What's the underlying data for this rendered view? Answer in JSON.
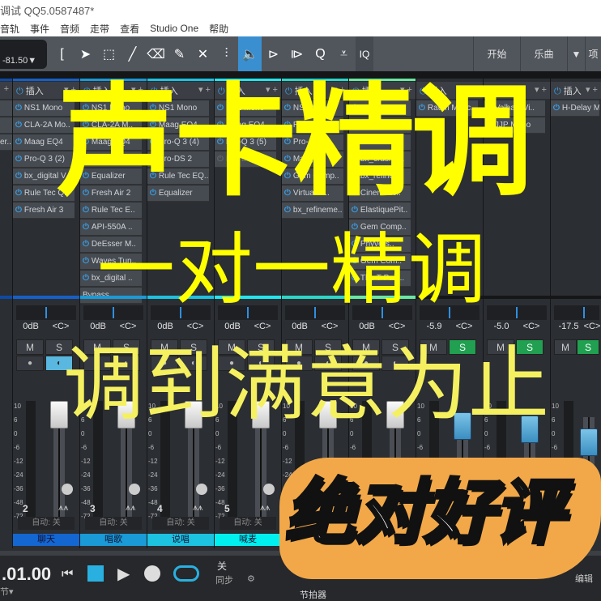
{
  "window": {
    "title": "调试 QQ5.0587487*"
  },
  "menu": [
    "音轨",
    "事件",
    "音频",
    "走带",
    "查看",
    "Studio One",
    "帮助"
  ],
  "toolbar": {
    "time": "-81.50▼",
    "tools": [
      "bracket",
      "arrow",
      "range",
      "paint",
      "eraser",
      "pencil",
      "mute",
      "split",
      "listen",
      "bend",
      "strip-silence",
      "quantize",
      "transform"
    ],
    "iq": "IQ",
    "buttons": [
      "开始",
      "乐曲",
      "▼",
      "项"
    ]
  },
  "insert_header": "插入",
  "strips": [
    {
      "num": "",
      "color": "#0d4aa6",
      "inserts": [
        "",
        "",
        "er.."
      ],
      "vol": "",
      "pan": "",
      "solo": false,
      "label": "",
      "label_color": "#1062c8"
    },
    {
      "num": "2",
      "color": "#1560c8",
      "inserts": [
        "NS1 Mono",
        "CLA-2A Mo..",
        "Maag EQ4",
        "Pro-Q 3 (2)",
        "bx_digital V",
        "Rule Tec Q..",
        "Fresh Air 3"
      ],
      "vol": "0dB",
      "pan": "<C>",
      "solo": false,
      "label": "聊天",
      "label_color": "#1466d0"
    },
    {
      "num": "3",
      "color": "#1a9ad6",
      "inserts": [
        "NS1 Mono",
        "CLA-2A M..",
        "Maag EQ4",
        "Pro-Q 3 (3)",
        "Equalizer",
        "Fresh Air 2",
        "Rule Tec E..",
        "API-550A ..",
        "DeEsser M..",
        "Waves Tun..",
        "bx_digital ..",
        "Bypass"
      ],
      "vol": "0dB",
      "pan": "<C>",
      "solo": false,
      "label": "唱歌",
      "label_color": "#1a9ad6"
    },
    {
      "num": "4",
      "color": "#1cc2e0",
      "inserts": [
        "NS1 Mono",
        "Maag EQ4",
        "Pro-Q 3 (4)",
        "Pro-DS 2",
        "Rule Tec EQ..",
        "Equalizer"
      ],
      "vol": "0dB",
      "pan": "<C>",
      "solo": false,
      "label": "说唱",
      "label_color": "#1cc2e0"
    },
    {
      "num": "5",
      "color": "#22e6ee",
      "inserts": [
        "NS1 Mono",
        "Maag EQ4",
        "Pro-Q 3 (5)",
        "Pro-DS 2"
      ],
      "vol": "0dB",
      "pan": "<C>",
      "solo": false,
      "label": "喊麦",
      "label_color": "#00f0f0"
    },
    {
      "num": "",
      "color": "#2ad8c8",
      "inserts": [
        "NS1 Mono",
        "RVox Mono",
        "Pro-Q..",
        "Maag..",
        "Gem Comp..",
        "Virtual M..",
        "bx_refineme.."
      ],
      "vol": "0dB",
      "pan": "<C>",
      "solo": false,
      "label": "",
      "label_color": ""
    },
    {
      "num": "",
      "color": "#68e8a0",
      "inserts": [
        "AVOX MUT..",
        "Abbey Road..",
        "Black Box..",
        "bx_crusher..",
        "bx_refiner..",
        "Cinematic..",
        "ElastiquePit..",
        "Gem Comp..",
        "Phyvers..",
        "Gem Com..",
        "The T-Pain.."
      ],
      "vol": "0dB",
      "pan": "<C>",
      "solo": false,
      "label": "",
      "label_color": ""
    },
    {
      "num": "",
      "color": "#2b2e33",
      "inserts": [
        "Raum Masc.."
      ],
      "vol": "-5.9",
      "pan": "<C>",
      "solo": true,
      "label": "",
      "label_color": ""
    },
    {
      "num": "",
      "color": "#2b2e33",
      "inserts": [
        "ValhallaVi..",
        "JJP Mono"
      ],
      "vol": "-5.0",
      "pan": "<C>",
      "solo": true,
      "label": "",
      "label_color": ""
    },
    {
      "num": "",
      "color": "#2b2e33",
      "inserts": [
        "H-Delay M.."
      ],
      "vol": "-17.5",
      "pan": "<C>",
      "solo": true,
      "label": "",
      "label_color": ""
    }
  ],
  "strip_labels": {
    "mute": "M",
    "solo": "S",
    "auto": "自动: 关"
  },
  "meter_scale": [
    "10",
    "6",
    "0",
    "-6",
    "-12",
    "-24",
    "-36",
    "-48",
    "-72"
  ],
  "transport": {
    "time": ".01.00",
    "unit": "节▾",
    "sync_off": "关",
    "sync": "同步",
    "metronome": "节拍器",
    "edit": "编辑"
  },
  "overlay": {
    "line1": "声卡精调",
    "line2": "一对一精调",
    "line3": "调到满意为止",
    "badge": "绝对好评",
    "yellow": "#ffff00",
    "yellow_light": "#f4f060",
    "badge_bg": "#f2a848"
  }
}
